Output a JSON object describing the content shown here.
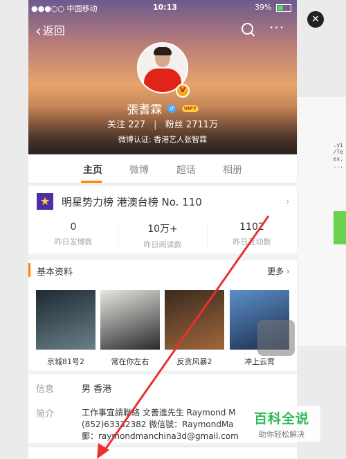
{
  "status_bar": {
    "carrier": "●●●○○ 中国移动",
    "time": "10:13",
    "battery": "39%"
  },
  "nav": {
    "back_label": "返回"
  },
  "profile": {
    "name": "張耆霖",
    "vip": "VIP7",
    "follow_label": "关注",
    "follow_count": "227",
    "fans_label": "粉丝",
    "fans_count": "2711万",
    "verified": "微博认证: 香港艺人张智霖",
    "badge": "V"
  },
  "tabs": [
    "主页",
    "微博",
    "超话",
    "相册"
  ],
  "rank": {
    "text": "明星势力榜  港澳台榜 No. 110"
  },
  "stats": [
    {
      "value": "0",
      "label": "昨日发博数"
    },
    {
      "value": "10万+",
      "label": "昨日阅读数"
    },
    {
      "value": "1102",
      "label": "昨日互动数"
    }
  ],
  "basic_info": {
    "title": "基本资料",
    "more": "更多"
  },
  "films": [
    {
      "title": "京城81号2",
      "color_a": "#1d2a33",
      "color_b": "#6b7f88"
    },
    {
      "title": "常在你左右",
      "color_a": "#e8e6e2",
      "color_b": "#2a2a2a"
    },
    {
      "title": "反贪风暴2",
      "color_a": "#3a2a1e",
      "color_b": "#a0673c"
    },
    {
      "title": "冲上云霄",
      "color_a": "#5b8fc9",
      "color_b": "#1d2c4a"
    }
  ],
  "info": {
    "label": "信息",
    "value": "男  香港"
  },
  "bio": {
    "label": "简介",
    "lines": [
      "工作事宜請聯絡 文善進先生 Raymond M",
      "(852)63332382 微信號：RaymondMa",
      "郵：raymondmanchina3d@gmail.com"
    ]
  },
  "watermark": {
    "title": "百科全说",
    "subtitle": "助你轻松解决"
  },
  "colors": {
    "accent": "#ff8200",
    "annotation_arrow": "#e8322c",
    "watermark_green": "#2dbb55"
  }
}
